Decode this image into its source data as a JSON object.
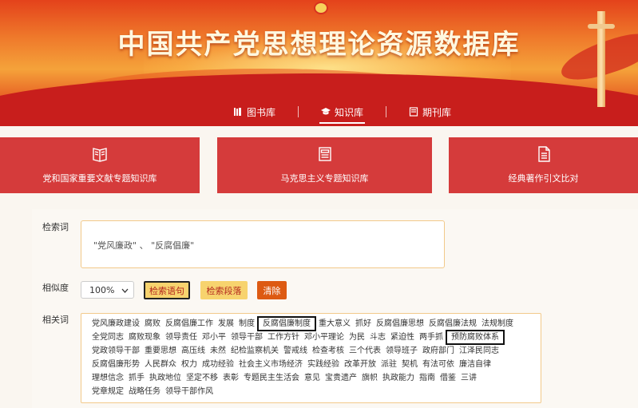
{
  "banner": {
    "title": "中国共产党思想理论资源数据库"
  },
  "nav": [
    {
      "label": "图书库",
      "icon": "book-stack-icon",
      "active": false
    },
    {
      "label": "知识库",
      "icon": "graduation-cap-icon",
      "active": true
    },
    {
      "label": "期刊库",
      "icon": "journal-icon",
      "active": false
    }
  ],
  "cards": [
    {
      "label": "党和国家重要文献专题知识库",
      "icon": "open-book-icon"
    },
    {
      "label": "马克思主义专题知识库",
      "icon": "newspaper-icon"
    },
    {
      "label": "经典著作引文比对",
      "icon": "document-icon"
    }
  ],
  "search": {
    "query_label": "检索词",
    "query_value": "\"党风廉政\" 、 \"反腐倡廉\"",
    "similarity_label": "相似度",
    "similarity_value": "100%",
    "btn_sentence": "检索语句",
    "btn_paragraph": "检索段落",
    "btn_clear": "清除",
    "related_label": "相关词"
  },
  "related_rows": [
    [
      "党风廉政建设",
      "腐败",
      "反腐倡廉工作",
      "发展",
      "制度",
      "反腐倡廉制度",
      "重大意义",
      "抓好",
      "反腐倡廉思想",
      "反腐倡廉法规",
      "法规制度"
    ],
    [
      "全党同志",
      "腐败现象",
      "领导责任",
      "邓小平",
      "领导干部",
      "工作方针",
      "邓小平理论",
      "为民",
      "斗志",
      "紧迫性",
      "两手抓",
      "预防腐败体系"
    ],
    [
      "党政领导干部",
      "重要思想",
      "高压线",
      "未然",
      "纪检监察机关",
      "警戒线",
      "检查考核",
      "三个代表",
      "领导班子",
      "政府部门",
      "江泽民同志"
    ],
    [
      "反腐倡廉形势",
      "人民群众",
      "权力",
      "成功经验",
      "社会主义市场经济",
      "实践经验",
      "改革开放",
      "派驻",
      "契机",
      "有法可依",
      "廉洁自律"
    ],
    [
      "理想信念",
      "抓手",
      "执政地位",
      "坚定不移",
      "表彰",
      "专题民主生活会",
      "意见",
      "宝贵遗产",
      "旗帜",
      "执政能力",
      "指南",
      "借鉴",
      "三讲"
    ],
    [
      "党章规定",
      "战略任务",
      "领导干部作风"
    ]
  ],
  "boxed_tags": [
    "反腐倡廉制度",
    "预防腐败体系"
  ]
}
